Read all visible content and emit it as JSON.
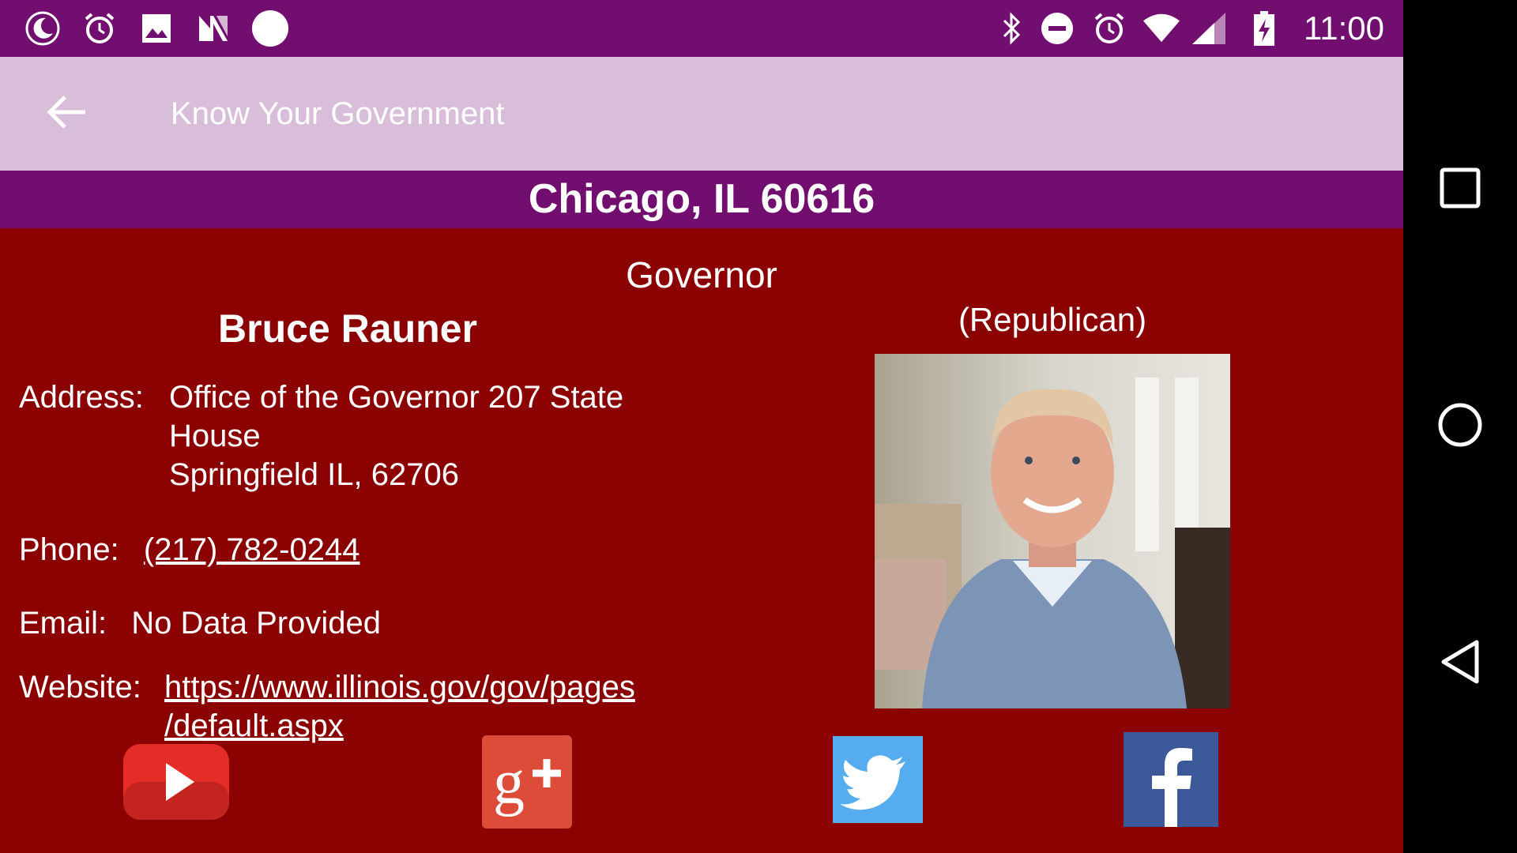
{
  "status_bar": {
    "time": "11:00",
    "left_icons": [
      "moon-icon",
      "alarm-icon",
      "image-icon",
      "n-logo-icon",
      "circle-icon"
    ],
    "right_icons": [
      "bluetooth-icon",
      "do-not-disturb-icon",
      "alarm-icon",
      "wifi-icon",
      "cell-signal-icon",
      "battery-charging-icon"
    ]
  },
  "app_bar": {
    "title": "Know Your Government",
    "back_icon": "arrow-back-icon"
  },
  "location": {
    "text": "Chicago, IL 60616"
  },
  "official": {
    "office": "Governor",
    "name": "Bruce Rauner",
    "party": "(Republican)",
    "address_label": "Address:",
    "address_line1": "Office of the Governor 207 State",
    "address_line2": "House",
    "address_line3": "Springfield IL, 62706",
    "phone_label": "Phone:",
    "phone": "(217) 782-0244",
    "email_label": "Email:",
    "email": "No Data Provided",
    "website_label": "Website:",
    "website_line1": "https://www.illinois.gov/gov/pages",
    "website_line2": "/default.aspx"
  },
  "social": [
    {
      "name": "youtube",
      "icon": "youtube-icon",
      "color": "#e52d27"
    },
    {
      "name": "google-plus",
      "icon": "google-plus-icon",
      "color": "#dd4b39"
    },
    {
      "name": "twitter",
      "icon": "twitter-icon",
      "color": "#55acee"
    },
    {
      "name": "facebook",
      "icon": "facebook-icon",
      "color": "#3b5998"
    }
  ],
  "colors": {
    "status_bar": "#720e6f",
    "app_bar": "#d8bed9",
    "banner": "#720e6f",
    "content_bg": "#8b0000"
  },
  "nav_bar": {
    "icons": [
      "recents-square-icon",
      "home-circle-icon",
      "back-triangle-icon"
    ]
  }
}
